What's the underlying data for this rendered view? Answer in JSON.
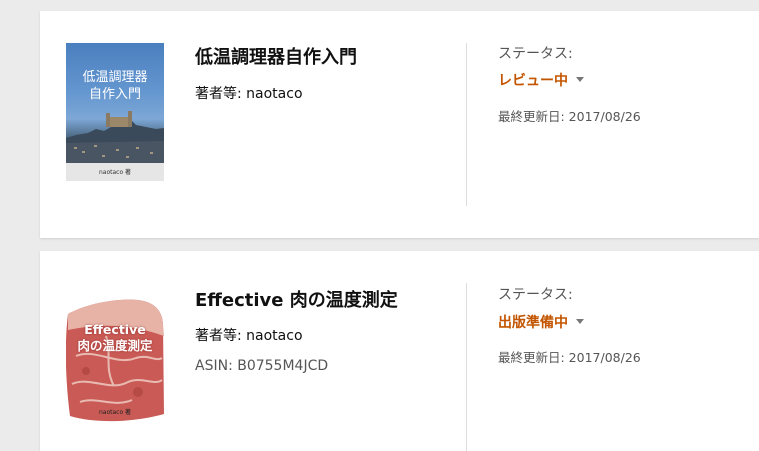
{
  "books": [
    {
      "title": "低温調理器自作入門",
      "author_line": "著者等: naotaco",
      "cover_title_line1": "低温調理器",
      "cover_title_line2": "自作入門",
      "cover_author": "naotaco 著",
      "status_label": "ステータス:",
      "status_value": "レビュー中",
      "updated": "最終更新日: 2017/08/26"
    },
    {
      "title": "Effective 肉の温度測定",
      "author_line": "著者等: naotaco",
      "asin_line": "ASIN: B0755M4JCD",
      "cover_title_line1": "Effective",
      "cover_title_line2": "肉の温度測定",
      "cover_author": "naotaco 著",
      "status_label": "ステータス:",
      "status_value": "出版準備中",
      "updated": "最終更新日: 2017/08/26"
    }
  ],
  "colors": {
    "status_accent": "#c45500",
    "page_bg": "#ebebeb"
  }
}
